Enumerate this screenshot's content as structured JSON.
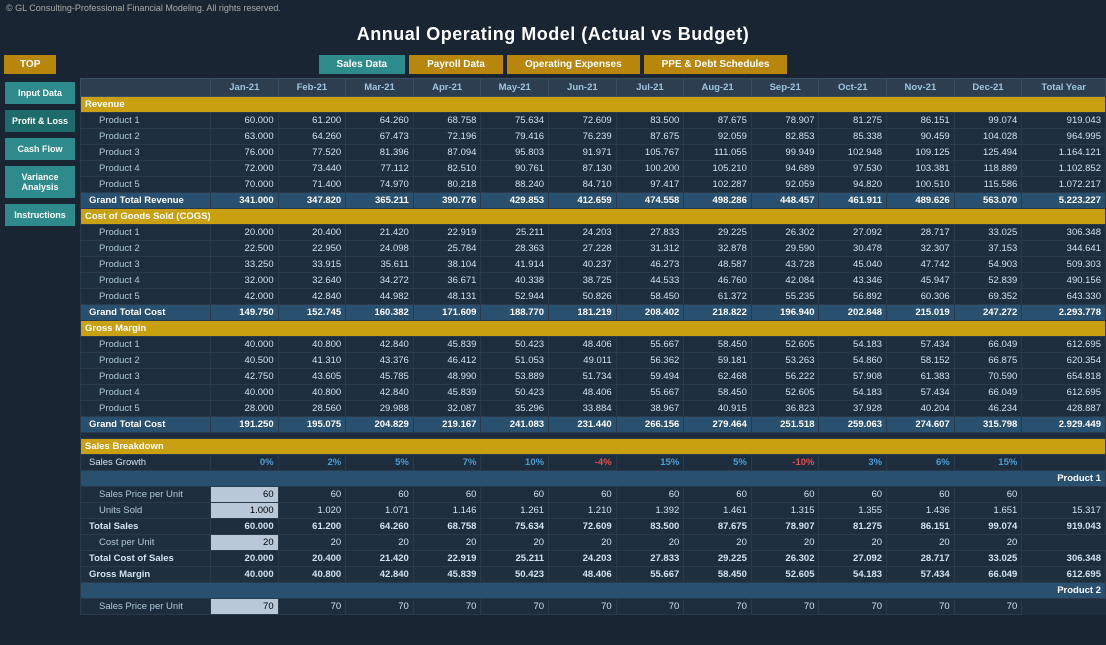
{
  "app": {
    "copyright": "© GL Consulting-Professional Financial Modeling. All rights reserved.",
    "title": "Annual Operating Model (Actual vs Budget)"
  },
  "nav": {
    "top_label": "TOP",
    "buttons": [
      "Sales Data",
      "Payroll Data",
      "Operating Expenses",
      "PPE & Debt Schedules"
    ]
  },
  "sidebar": {
    "items": [
      {
        "label": "Input Data"
      },
      {
        "label": "Profit & Loss"
      },
      {
        "label": "Cash Flow"
      },
      {
        "label": "Variance Analysis"
      },
      {
        "label": "Instructions"
      }
    ]
  },
  "table": {
    "columns": [
      "Jan-21",
      "Feb-21",
      "Mar-21",
      "Apr-21",
      "May-21",
      "Jun-21",
      "Jul-21",
      "Aug-21",
      "Sep-21",
      "Oct-21",
      "Nov-21",
      "Dec-21",
      "Total Year"
    ],
    "sections": [
      {
        "title": "Revenue",
        "rows": [
          {
            "label": "Product 1",
            "values": [
              "60.000",
              "61.200",
              "64.260",
              "68.758",
              "75.634",
              "72.609",
              "83.500",
              "87.675",
              "78.907",
              "81.275",
              "86.151",
              "99.074",
              "919.043"
            ]
          },
          {
            "label": "Product 2",
            "values": [
              "63.000",
              "64.260",
              "67.473",
              "72.196",
              "79.416",
              "76.239",
              "87.675",
              "92.059",
              "82.853",
              "85.338",
              "90.459",
              "104.028",
              "964.995"
            ]
          },
          {
            "label": "Product 3",
            "values": [
              "76.000",
              "77.520",
              "81.396",
              "87.094",
              "95.803",
              "91.971",
              "105.767",
              "111.055",
              "99.949",
              "102.948",
              "109.125",
              "125.494",
              "1.164.121"
            ]
          },
          {
            "label": "Product 4",
            "values": [
              "72.000",
              "73.440",
              "77.112",
              "82.510",
              "90.761",
              "87.130",
              "100.200",
              "105.210",
              "94.689",
              "97.530",
              "103.381",
              "118.889",
              "1.102.852"
            ]
          },
          {
            "label": "Product 5",
            "values": [
              "70.000",
              "71.400",
              "74.970",
              "80.218",
              "88.240",
              "84.710",
              "97.417",
              "102.287",
              "92.059",
              "94.820",
              "100.510",
              "115.586",
              "1.072.217"
            ]
          },
          {
            "label": "Grand Total Revenue",
            "values": [
              "341.000",
              "347.820",
              "365.211",
              "390.776",
              "429.853",
              "412.659",
              "474.558",
              "498.286",
              "448.457",
              "461.911",
              "489.626",
              "563.070",
              "5.223.227"
            ],
            "total": true
          }
        ]
      },
      {
        "title": "Cost of Goods Sold (COGS)",
        "rows": [
          {
            "label": "Product 1",
            "values": [
              "20.000",
              "20.400",
              "21.420",
              "22.919",
              "25.211",
              "24.203",
              "27.833",
              "29.225",
              "26.302",
              "27.092",
              "28.717",
              "33.025",
              "306.348"
            ]
          },
          {
            "label": "Product 2",
            "values": [
              "22.500",
              "22.950",
              "24.098",
              "25.784",
              "28.363",
              "27.228",
              "31.312",
              "32.878",
              "29.590",
              "30.478",
              "32.307",
              "37.153",
              "344.641"
            ]
          },
          {
            "label": "Product 3",
            "values": [
              "33.250",
              "33.915",
              "35.611",
              "38.104",
              "41.914",
              "40.237",
              "46.273",
              "48.587",
              "43.728",
              "45.040",
              "47.742",
              "54.903",
              "509.303"
            ]
          },
          {
            "label": "Product 4",
            "values": [
              "32.000",
              "32.640",
              "34.272",
              "36.671",
              "40.338",
              "38.725",
              "44.533",
              "46.760",
              "42.084",
              "43.346",
              "45.947",
              "52.839",
              "490.156"
            ]
          },
          {
            "label": "Product 5",
            "values": [
              "42.000",
              "42.840",
              "44.982",
              "48.131",
              "52.944",
              "50.826",
              "58.450",
              "61.372",
              "55.235",
              "56.892",
              "60.306",
              "69.352",
              "643.330"
            ]
          },
          {
            "label": "Grand Total Cost",
            "values": [
              "149.750",
              "152.745",
              "160.382",
              "171.609",
              "188.770",
              "181.219",
              "208.402",
              "218.822",
              "196.940",
              "202.848",
              "215.019",
              "247.272",
              "2.293.778"
            ],
            "total": true
          }
        ]
      },
      {
        "title": "Gross Margin",
        "rows": [
          {
            "label": "Product 1",
            "values": [
              "40.000",
              "40.800",
              "42.840",
              "45.839",
              "50.423",
              "48.406",
              "55.667",
              "58.450",
              "52.605",
              "54.183",
              "57.434",
              "66.049",
              "612.695"
            ]
          },
          {
            "label": "Product 2",
            "values": [
              "40.500",
              "41.310",
              "43.376",
              "46.412",
              "51.053",
              "49.011",
              "56.362",
              "59.181",
              "53.263",
              "54.860",
              "58.152",
              "66.875",
              "620.354"
            ]
          },
          {
            "label": "Product 3",
            "values": [
              "42.750",
              "43.605",
              "45.785",
              "48.990",
              "53.889",
              "51.734",
              "59.494",
              "62.468",
              "56.222",
              "57.908",
              "61.383",
              "70.590",
              "654.818"
            ]
          },
          {
            "label": "Product 4",
            "values": [
              "40.000",
              "40.800",
              "42.840",
              "45.839",
              "50.423",
              "48.406",
              "55.667",
              "58.450",
              "52.605",
              "54.183",
              "57.434",
              "66.049",
              "612.695"
            ]
          },
          {
            "label": "Product 5",
            "values": [
              "28.000",
              "28.560",
              "29.988",
              "32.087",
              "35.296",
              "33.884",
              "38.967",
              "40.915",
              "36.823",
              "37.928",
              "40.204",
              "46.234",
              "428.887"
            ]
          },
          {
            "label": "Grand Total Cost",
            "values": [
              "191.250",
              "195.075",
              "204.829",
              "219.167",
              "241.083",
              "231.440",
              "266.156",
              "279.464",
              "251.518",
              "259.063",
              "274.607",
              "315.798",
              "2.929.449"
            ],
            "total": true
          }
        ]
      }
    ],
    "sales_breakdown": {
      "title": "Sales Breakdown",
      "growth_row": {
        "label": "Sales Growth",
        "values": [
          "0%",
          "2%",
          "5%",
          "7%",
          "10%",
          "-4%",
          "15%",
          "5%",
          "-10%",
          "3%",
          "6%",
          "15%"
        ],
        "colors": [
          "blue",
          "blue",
          "blue",
          "blue",
          "blue",
          "red",
          "blue",
          "blue",
          "red",
          "blue",
          "blue",
          "blue"
        ]
      },
      "products": [
        {
          "name": "Product 1",
          "rows": [
            {
              "label": "Sales Price per Unit",
              "values": [
                "60",
                "60",
                "60",
                "60",
                "60",
                "60",
                "60",
                "60",
                "60",
                "60",
                "60",
                "60"
              ],
              "first_highlight": true
            },
            {
              "label": "Units Sold",
              "values": [
                "1.000",
                "1.020",
                "1.071",
                "1.146",
                "1.261",
                "1.210",
                "1.392",
                "1.461",
                "1.315",
                "1.355",
                "1.436",
                "1.651",
                "15.317"
              ],
              "first_highlight": true
            },
            {
              "label": "Total Sales",
              "values": [
                "60.000",
                "61.200",
                "64.260",
                "68.758",
                "75.634",
                "72.609",
                "83.500",
                "87.675",
                "78.907",
                "81.275",
                "86.151",
                "99.074",
                "919.043"
              ],
              "bold": true
            },
            {
              "label": "Cost per Unit",
              "values": [
                "20",
                "20",
                "20",
                "20",
                "20",
                "20",
                "20",
                "20",
                "20",
                "20",
                "20",
                "20"
              ],
              "first_highlight": true
            },
            {
              "label": "Total Cost of Sales",
              "values": [
                "20.000",
                "20.400",
                "21.420",
                "22.919",
                "25.211",
                "24.203",
                "27.833",
                "29.225",
                "26.302",
                "27.092",
                "28.717",
                "33.025",
                "306.348"
              ],
              "bold": true
            },
            {
              "label": "Gross Margin",
              "values": [
                "40.000",
                "40.800",
                "42.840",
                "45.839",
                "50.423",
                "48.406",
                "55.667",
                "58.450",
                "52.605",
                "54.183",
                "57.434",
                "66.049",
                "612.695"
              ],
              "bold": true
            }
          ]
        },
        {
          "name": "Product 2",
          "rows": [
            {
              "label": "Sales Price per Unit",
              "values": [
                "70",
                "70",
                "70",
                "70",
                "70",
                "70",
                "70",
                "70",
                "70",
                "70",
                "70",
                "70"
              ],
              "first_highlight": true
            }
          ]
        }
      ]
    }
  }
}
